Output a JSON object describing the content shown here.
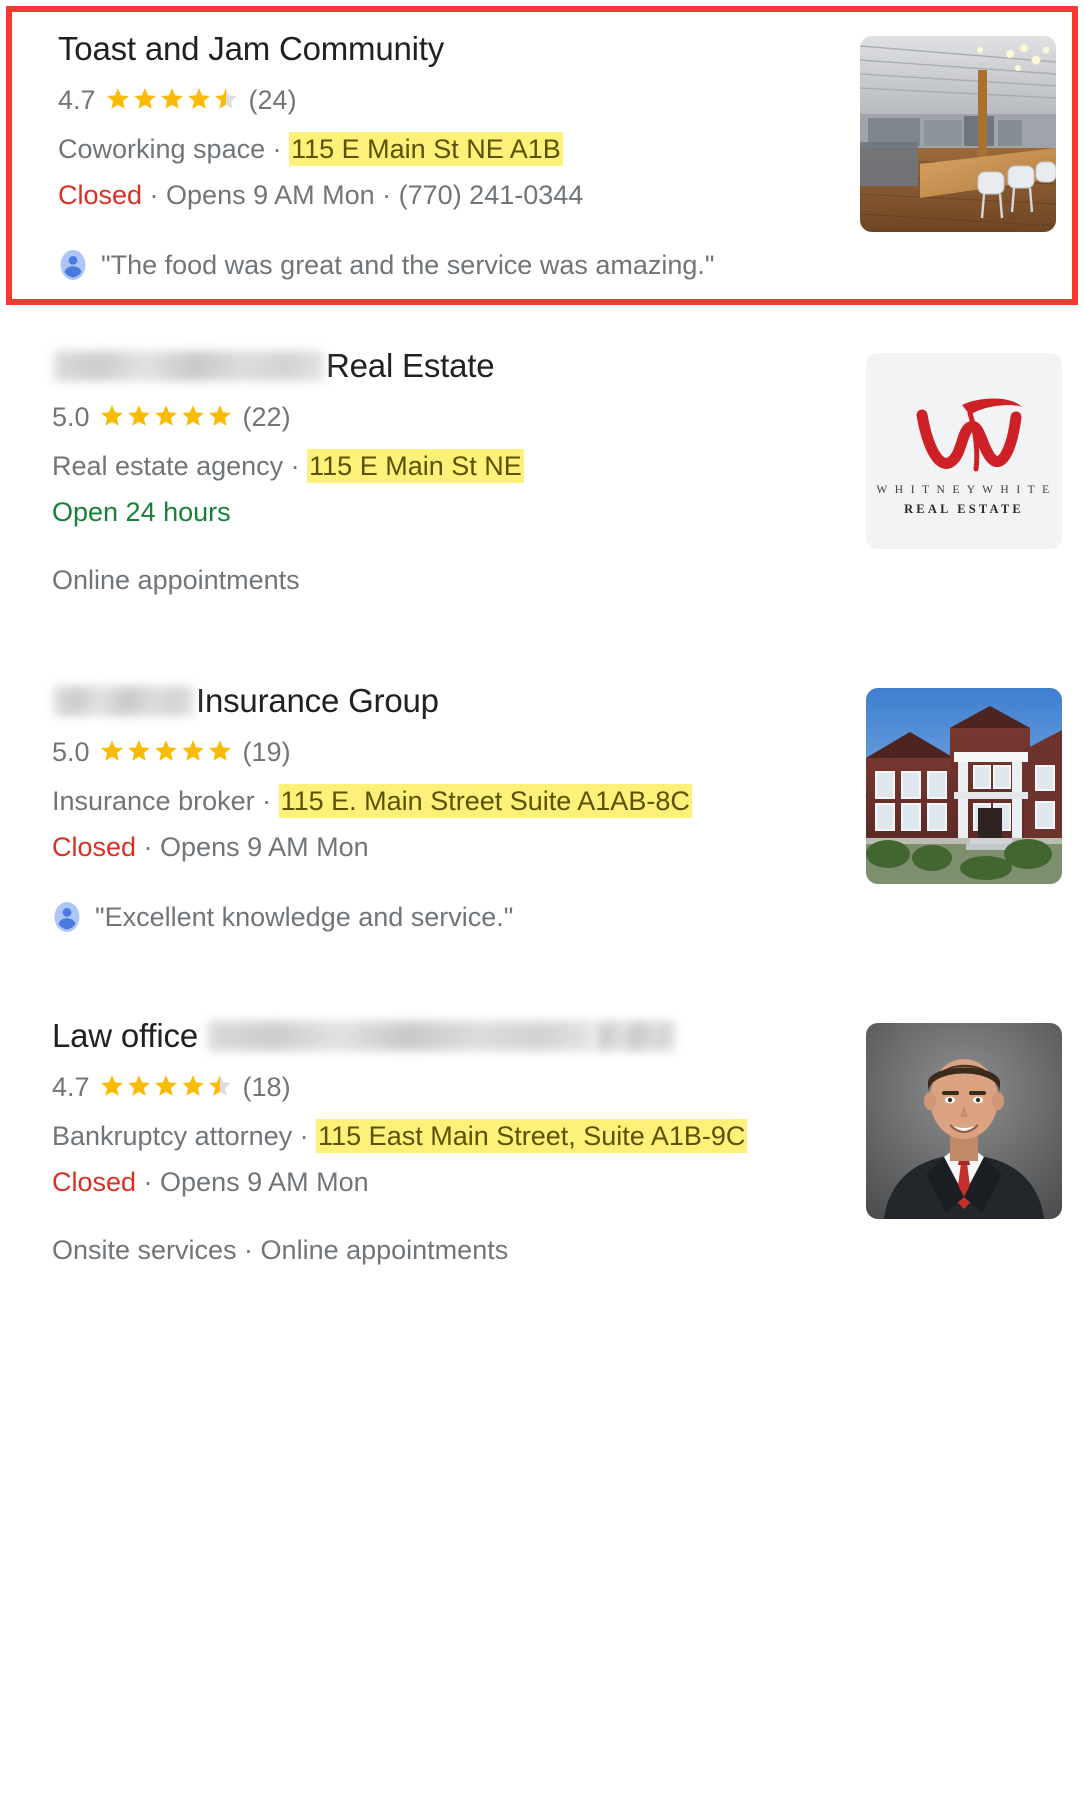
{
  "page": {
    "kind": "local-business-results",
    "highlight_color": "#f33a32",
    "address_highlight_color": "#fdf17a",
    "closed_color": "#d93025",
    "open_color": "#188038"
  },
  "results": [
    {
      "id": "toast-and-jam-community",
      "highlighted": true,
      "title_prefix": "",
      "title": "Toast and Jam Community",
      "title_redacted_before": false,
      "rating": "4.7",
      "stars": 4.5,
      "review_count": "(24)",
      "category": "Coworking space",
      "separator": " · ",
      "address": "115 E Main St NE A1B",
      "status": "Closed",
      "status_type": "closed",
      "hours": " · Opens 9 AM Mon",
      "phone": " · (770) 241-0344",
      "review_quote": "\"The food was great and the service was amazing.\"",
      "thumbnail": "coworking-interior-photo",
      "extra": ""
    },
    {
      "id": "whitney-white-real-estate",
      "highlighted": false,
      "title_prefix": "",
      "title": "Real Estate",
      "title_redacted_before": true,
      "redacted_width": 270,
      "rating": "5.0",
      "stars": 5,
      "review_count": "(22)",
      "category": "Real estate agency",
      "separator": " · ",
      "address": "115 E Main St NE",
      "status": "Open 24 hours",
      "status_type": "open",
      "hours": "",
      "phone": "",
      "review_quote": "",
      "thumbnail": "whitney-white-real-estate-logo",
      "extra": "Online appointments"
    },
    {
      "id": "insurance-group",
      "highlighted": false,
      "title_prefix": "",
      "title": "Insurance Group",
      "title_redacted_before": true,
      "redacted_width": 140,
      "rating": "5.0",
      "stars": 5,
      "review_count": "(19)",
      "category": "Insurance broker",
      "separator": " · ",
      "address": "115 E. Main Street Suite A1AB-8C",
      "status": "Closed",
      "status_type": "closed",
      "hours": " · Opens 9 AM Mon",
      "phone": "",
      "review_quote": "\"Excellent knowledge and service.\"",
      "thumbnail": "brick-office-building-photo",
      "extra": ""
    },
    {
      "id": "law-office",
      "highlighted": false,
      "title_prefix": "Law office",
      "title": "",
      "title_redacted_after": true,
      "redacted_width": 385,
      "redacted_width_2": 80,
      "rating": "4.7",
      "stars": 4.5,
      "review_count": "(18)",
      "category": "Bankruptcy attorney",
      "separator": " · ",
      "address": "115 East Main Street, Suite A1B-9C",
      "status": "Closed",
      "status_type": "closed",
      "hours": " · Opens 9 AM Mon",
      "phone": "",
      "review_quote": "",
      "thumbnail": "attorney-headshot-photo",
      "extra": "Onsite services · Online appointments"
    }
  ],
  "icons": {
    "star": "star-icon",
    "half_star": "half-star-icon",
    "avatar": "reviewer-avatar-icon"
  }
}
